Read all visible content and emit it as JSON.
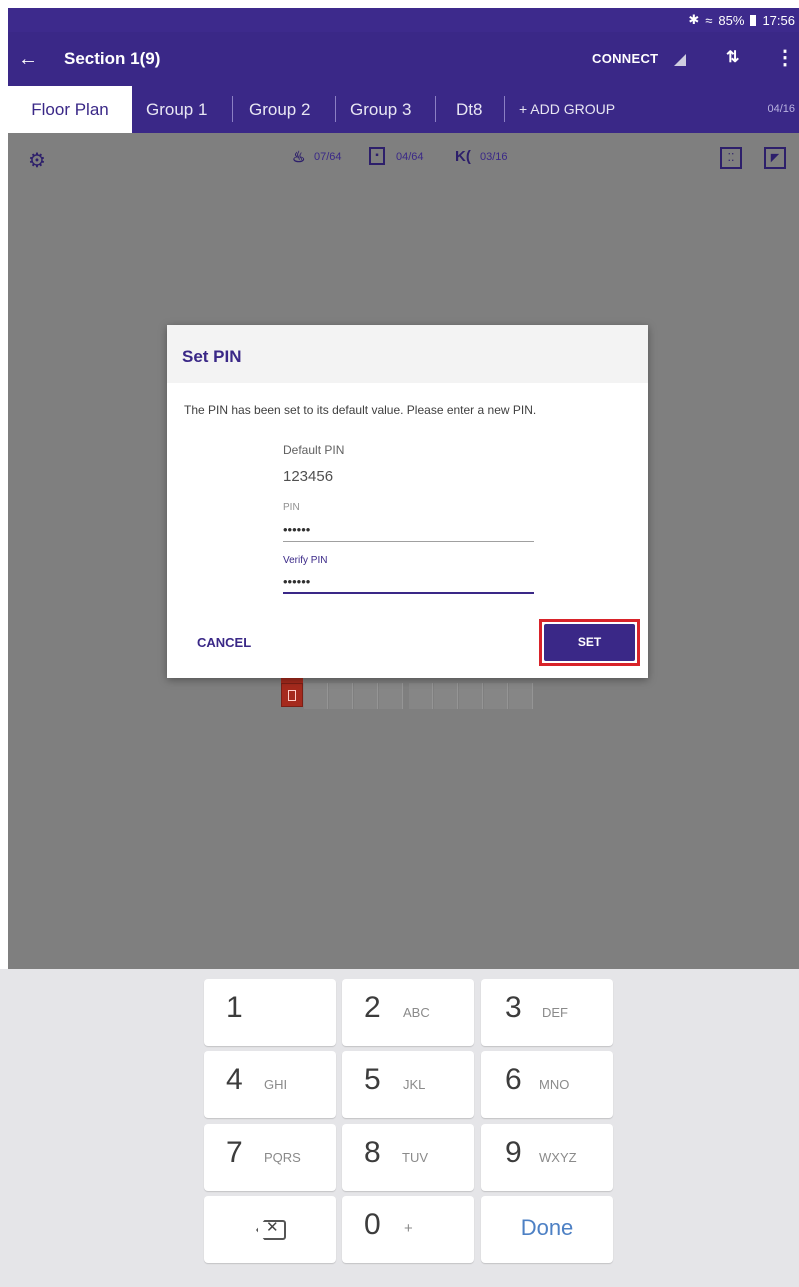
{
  "status_bar": {
    "bluetooth": "✱",
    "wifi": "≈",
    "battery": "85%",
    "time": "17:56"
  },
  "app_bar": {
    "back_icon": "back-arrow-icon",
    "title": "Section 1(9)",
    "connect_label": "CONNECT"
  },
  "tabs": {
    "items": [
      {
        "label": "Floor Plan",
        "active": true
      },
      {
        "label": "Group 1",
        "active": false
      },
      {
        "label": "Group 2",
        "active": false
      },
      {
        "label": "Group 3",
        "active": false
      },
      {
        "label": "Dt8",
        "active": false
      }
    ],
    "add_group_label": "+ ADD GROUP",
    "count": "04/16"
  },
  "toolbar": {
    "luminaires": "07/64",
    "switches": "04/64",
    "sensors": "03/16"
  },
  "dialog": {
    "title": "Set PIN",
    "message": "The PIN has been set to its default value. Please enter a new PIN.",
    "default_pin_label": "Default PIN",
    "default_pin_value": "123456",
    "pin_label": "PIN",
    "pin_value": "••••••",
    "verify_pin_label": "Verify PIN",
    "verify_pin_value": "••••••",
    "cancel_label": "CANCEL",
    "set_label": "SET"
  },
  "keyboard": {
    "rows": [
      [
        {
          "num": "1",
          "letters": ""
        },
        {
          "num": "2",
          "letters": "ABC"
        },
        {
          "num": "3",
          "letters": "DEF"
        }
      ],
      [
        {
          "num": "4",
          "letters": "GHI"
        },
        {
          "num": "5",
          "letters": "JKL"
        },
        {
          "num": "6",
          "letters": "MNO"
        }
      ],
      [
        {
          "num": "7",
          "letters": "PQRS"
        },
        {
          "num": "8",
          "letters": "TUV"
        },
        {
          "num": "9",
          "letters": "WXYZ"
        }
      ]
    ],
    "zero": {
      "num": "0",
      "letters": "+"
    },
    "done_label": "Done"
  },
  "colors": {
    "primary": "#3a2887",
    "highlight": "#d8232a",
    "device": "#a52a1d",
    "canvas": "#7f7f7f"
  }
}
